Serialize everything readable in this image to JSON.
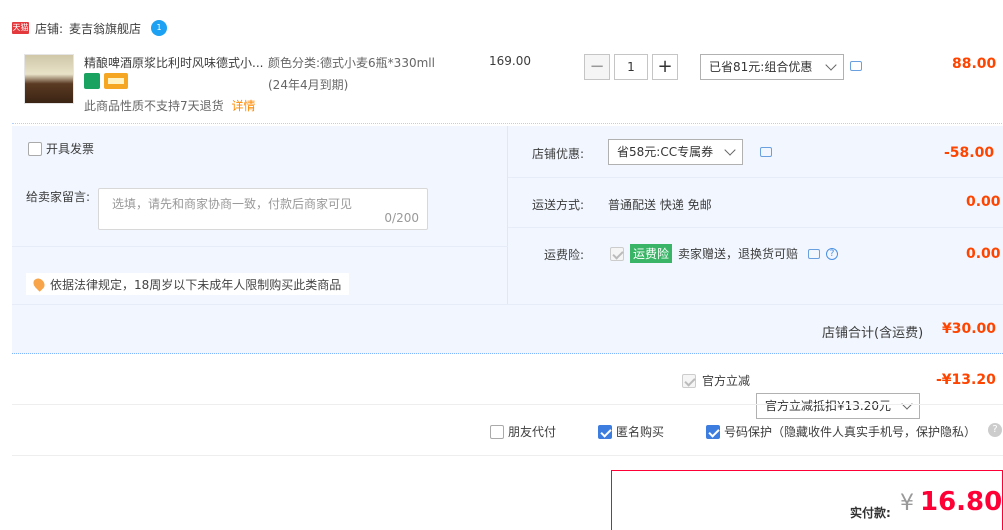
{
  "shop": {
    "badge": "天猫",
    "label": "店铺:",
    "name": "麦吉翁旗舰店",
    "ww_badge": "1"
  },
  "item": {
    "title": "精酿啤酒原浆比利时风味德式小...",
    "sku_label": "颜色分类:",
    "sku_value_line1": "德式小麦6瓶*330mll",
    "sku_value_line2": "(24年4月到期)",
    "price": "169.00",
    "quantity": "1",
    "qty_minus": "−",
    "qty_plus": "+",
    "promo_select": "已省81元:组合优惠",
    "subtotal": "88.00",
    "no_return_text": "此商品性质不支持7天退货",
    "details_link": "详情"
  },
  "invoice": {
    "label": "开具发票"
  },
  "seller_message": {
    "label": "给卖家留言:",
    "placeholder": "选填，请先和商家协商一致，付款后商家可见",
    "counter": "0/200"
  },
  "legal_notice": "依据法律规定，18周岁以下未成年人限制购买此类商品",
  "shop_discount": {
    "label": "店铺优惠:",
    "select": "省58元:CC专属券",
    "amount": "-58.00"
  },
  "shipping": {
    "label": "运送方式:",
    "method": "普通配送 快递 免邮",
    "amount": "0.00"
  },
  "insurance": {
    "label": "运费险:",
    "tag": "运费险",
    "desc": "卖家赠送，退换货可赔",
    "amount": "0.00"
  },
  "shop_total": {
    "label": "店铺合计(含运费)",
    "amount": "¥30.00"
  },
  "official": {
    "label": "官方立减",
    "select": "官方立减抵扣¥13.20元",
    "amount": "-¥13.20"
  },
  "options": {
    "friend_pay": "朋友代付",
    "anonymous": "匿名购买",
    "privacy": "号码保护（隐藏收件人真实手机号，保护隐私）"
  },
  "payment": {
    "label": "实付款:",
    "currency": "¥",
    "amount": "16.80"
  },
  "colors": {
    "accent": "#ff4400",
    "pay_red": "#ff0036",
    "panel_bg": "#f2f7ff",
    "check_blue": "#3d7de0"
  }
}
